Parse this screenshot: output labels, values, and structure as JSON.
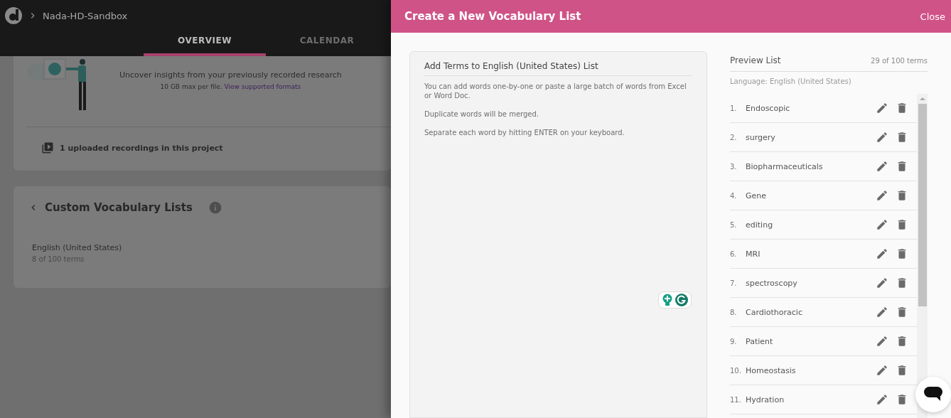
{
  "app": {
    "breadcrumb": "Nada-HD-Sandbox"
  },
  "tabs": [
    {
      "label": "OVERVIEW",
      "selected": true
    },
    {
      "label": "CALENDAR",
      "selected": false
    }
  ],
  "upload": {
    "headline": "Uncover insights from your previously recorded research",
    "note": "10 GB max per file.",
    "link": "View supported formats",
    "recordings": "1 uploaded recordings in this project"
  },
  "vocabulary": {
    "title": "Custom Vocabulary Lists",
    "lists": [
      {
        "name": "English (United States)",
        "count": "8 of 100 terms"
      }
    ]
  },
  "drawer": {
    "title": "Create a New Vocabulary List",
    "close": "Close",
    "add_terms": {
      "title": "Add Terms to English (United States) List",
      "hints": [
        "You can add words one-by-one or paste a large batch of words from Excel or Word Doc.",
        "Duplicate words will be merged.",
        "Separate each word by hitting ENTER on your keyboard."
      ]
    },
    "preview": {
      "title": "Preview List",
      "count": "29 of 100 terms",
      "language": "Language: English (United States)",
      "terms": [
        {
          "number": "1.",
          "term": "Endoscopic"
        },
        {
          "number": "2.",
          "term": "surgery"
        },
        {
          "number": "3.",
          "term": "Biopharmaceuticals"
        },
        {
          "number": "4.",
          "term": "Gene"
        },
        {
          "number": "5.",
          "term": "editing"
        },
        {
          "number": "6.",
          "term": "MRI"
        },
        {
          "number": "7.",
          "term": "spectroscopy"
        },
        {
          "number": "8.",
          "term": "Cardiothoracic"
        },
        {
          "number": "9.",
          "term": "Patient"
        },
        {
          "number": "10.",
          "term": "Homeostasis"
        },
        {
          "number": "11.",
          "term": "Hydration"
        }
      ]
    }
  }
}
